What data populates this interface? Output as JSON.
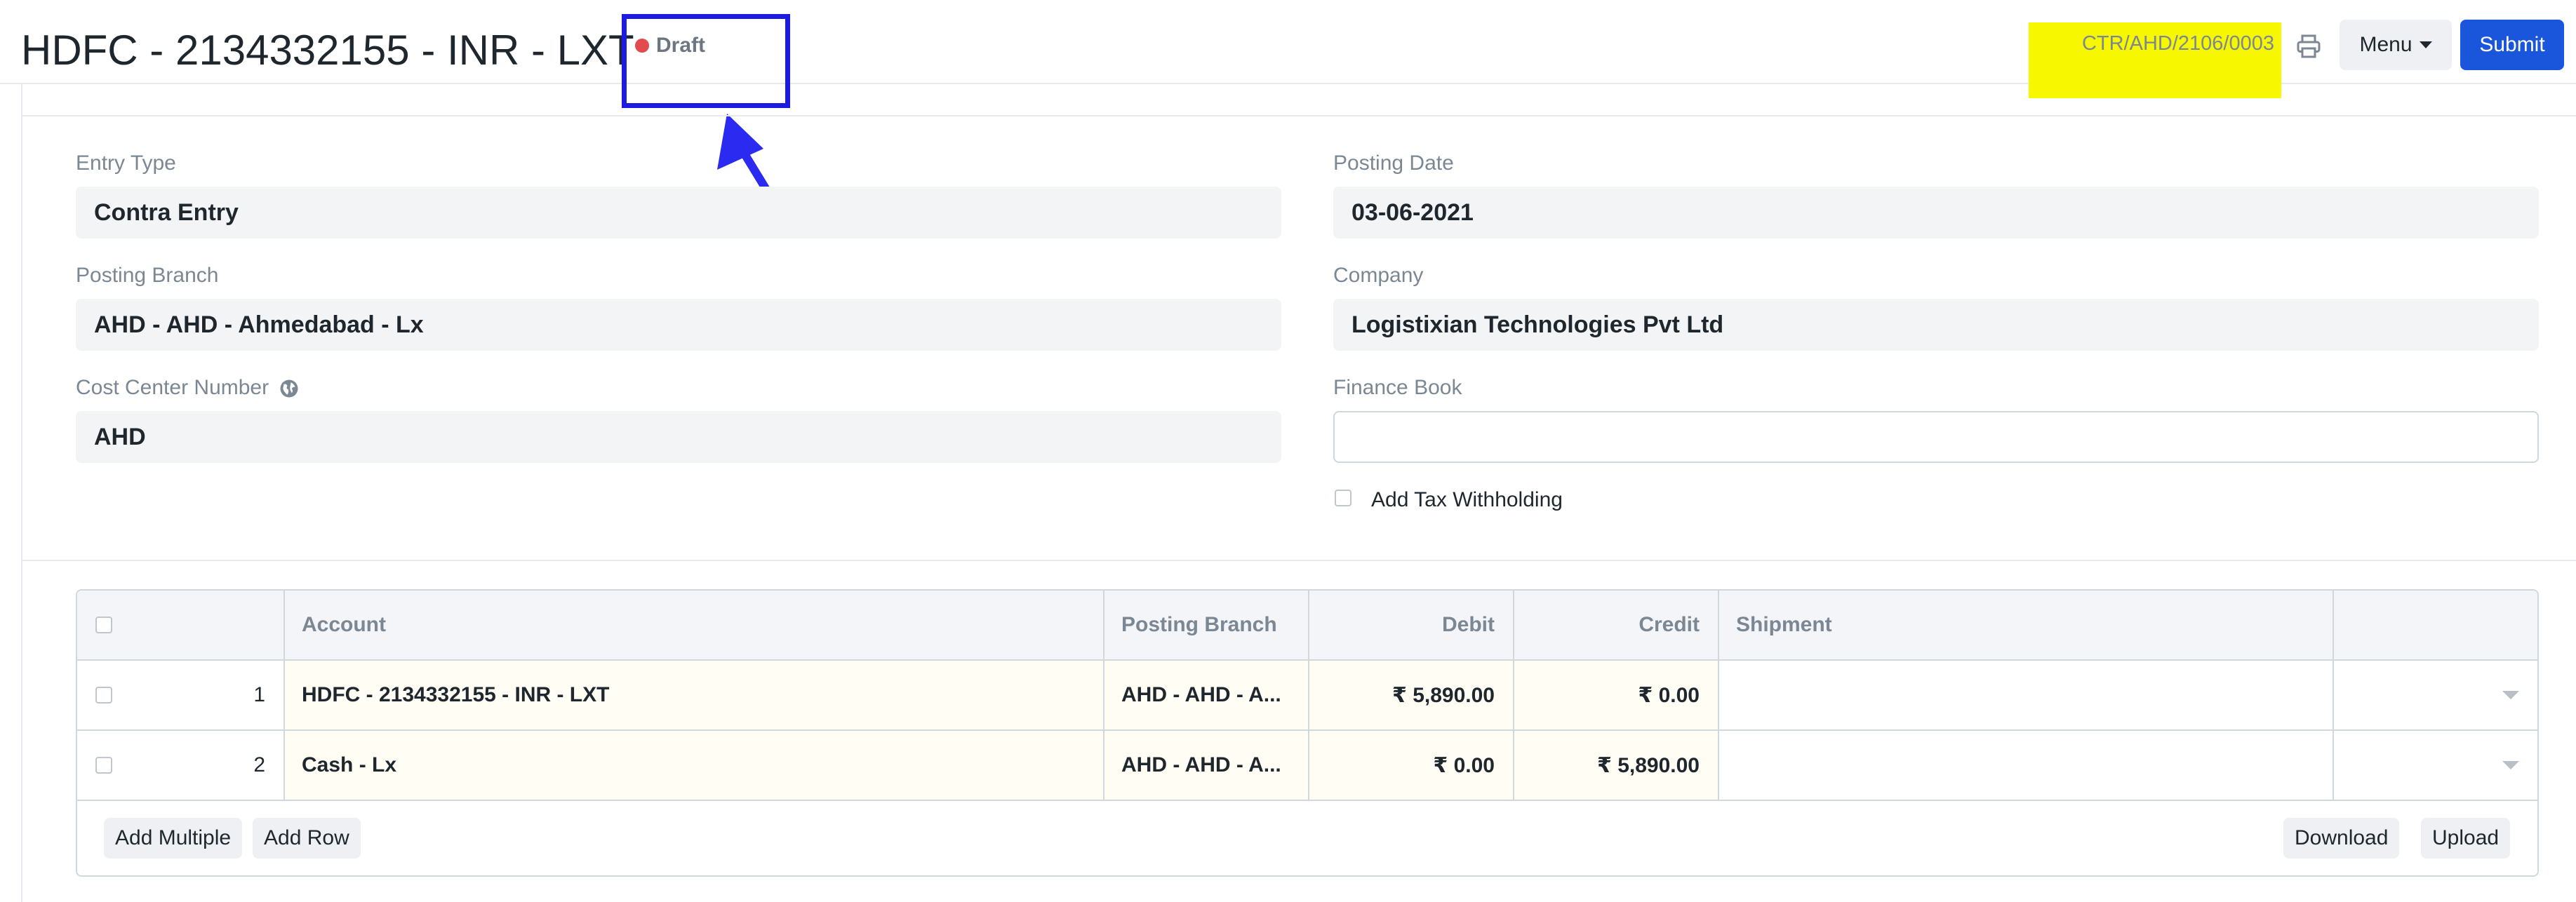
{
  "header": {
    "title": "HDFC - 2134332155 - INR - LXT",
    "status": "Draft",
    "status_color": "#e24c4c",
    "document_id": "CTR/AHD/2106/0003",
    "menu_label": "Menu",
    "submit_label": "Submit",
    "accent_color": "#1a56db",
    "highlight_color": "#f7f700",
    "annotation_color": "#1c1ce0"
  },
  "form": {
    "entry_type": {
      "label": "Entry Type",
      "value": "Contra Entry"
    },
    "posting_date": {
      "label": "Posting Date",
      "value": "03-06-2021"
    },
    "posting_branch": {
      "label": "Posting Branch",
      "value": "AHD - AHD - Ahmedabad - Lx"
    },
    "company": {
      "label": "Company",
      "value": "Logistixian Technologies Pvt Ltd"
    },
    "cost_center": {
      "label": "Cost Center Number",
      "value": "AHD",
      "icon": "globe-icon"
    },
    "finance_book": {
      "label": "Finance Book",
      "value": ""
    },
    "add_tax_withholding": {
      "label": "Add Tax Withholding",
      "checked": false
    }
  },
  "accounts_table": {
    "columns": [
      "Account",
      "Posting Branch",
      "Debit",
      "Credit",
      "Shipment"
    ],
    "rows": [
      {
        "idx": "1",
        "account": "HDFC - 2134332155 - INR - LXT",
        "posting_branch": "AHD - AHD - A...",
        "debit": "₹ 5,890.00",
        "credit": "₹ 0.00",
        "shipment": ""
      },
      {
        "idx": "2",
        "account": "Cash - Lx",
        "posting_branch": "AHD - AHD - A...",
        "debit": "₹ 0.00",
        "credit": "₹ 5,890.00",
        "shipment": ""
      }
    ],
    "buttons": {
      "add_multiple": "Add Multiple",
      "add_row": "Add Row",
      "download": "Download",
      "upload": "Upload"
    }
  }
}
